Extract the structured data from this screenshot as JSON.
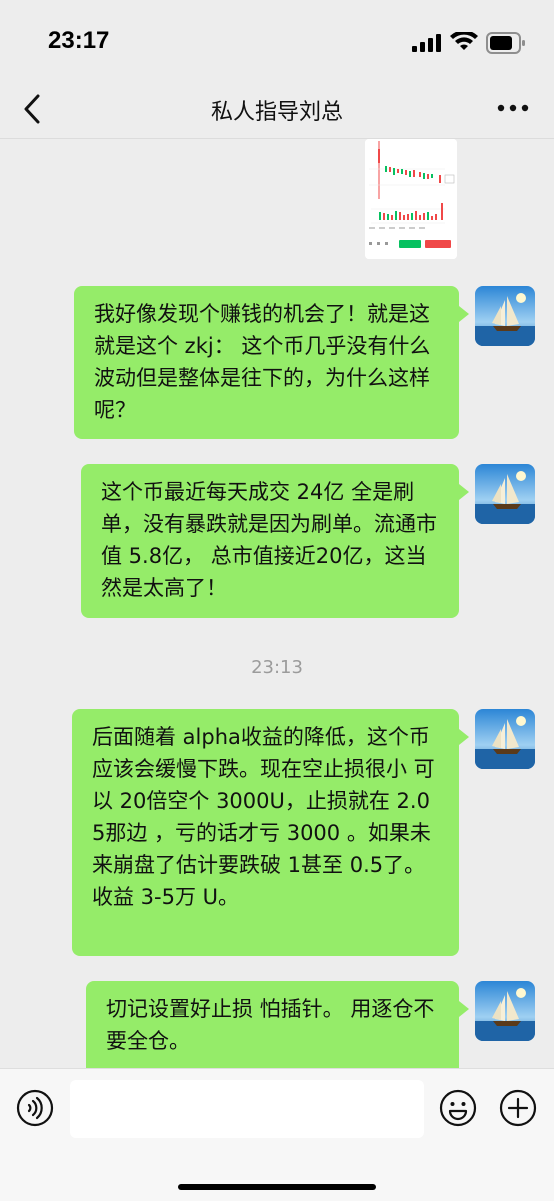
{
  "status_bar": {
    "time": "23:17"
  },
  "nav": {
    "title": "私人指导刘总"
  },
  "chat": {
    "messages": [
      {
        "sender": "self",
        "text": "我好像发现个赚钱的机会了！就是这就是这个 zkj： 这个币几乎没有什么波动但是整体是往下的，为什么这样呢？"
      },
      {
        "sender": "self",
        "text": "这个币最近每天成交 24亿 全是刷单，没有暴跌就是因为刷单。流通市值 5.8亿， 总市值接近20亿，这当然是太高了！"
      },
      {
        "sender": "self",
        "text": "后面随着 alpha收益的降低，这个币应该会缓慢下跌。现在空止损很小 可以 20倍空个 3000U，止损就在 2.05那边 ，亏的话才亏 3000 。如果未来崩盘了估计要跌破 1甚至 0.5了。收益 3-5万 U。"
      },
      {
        "sender": "self",
        "text": "切记设置好止损 怕插针。 用逐仓不要全仓。"
      }
    ],
    "timestamp": "23:13"
  },
  "input_bar": {
    "placeholder": ""
  },
  "colors": {
    "bubble_self": "#95ec69",
    "background": "#ededed",
    "buy_button": "#07c160",
    "sell_button": "#f04848"
  }
}
